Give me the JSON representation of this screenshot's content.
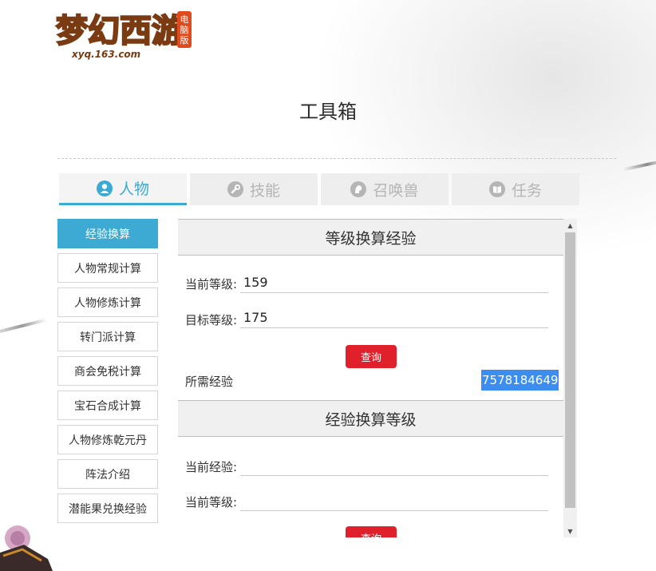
{
  "header": {
    "logo_text": "梦幻西游",
    "logo_badge": "电脑版",
    "logo_url_text": "xyq.163.com"
  },
  "page": {
    "title": "工具箱"
  },
  "tabs": [
    {
      "label": "人物",
      "icon": "person-icon",
      "active": true
    },
    {
      "label": "技能",
      "icon": "wrench-icon",
      "active": false
    },
    {
      "label": "召唤兽",
      "icon": "pet-icon",
      "active": false
    },
    {
      "label": "任务",
      "icon": "book-icon",
      "active": false
    }
  ],
  "submenu": [
    {
      "label": "经验换算",
      "active": true
    },
    {
      "label": "人物常规计算"
    },
    {
      "label": "人物修炼计算"
    },
    {
      "label": "转门派计算"
    },
    {
      "label": "商会免税计算"
    },
    {
      "label": "宝石合成计算"
    },
    {
      "label": "人物修炼乾元丹"
    },
    {
      "label": "阵法介绍"
    },
    {
      "label": "潜能果兑换经验"
    }
  ],
  "level_to_exp": {
    "title": "等级换算经验",
    "current_level_label": "当前等级:",
    "current_level_value": "159",
    "target_level_label": "目标等级:",
    "target_level_value": "175",
    "query_label": "查询",
    "result_label": "所需经验",
    "result_value": "7578184649"
  },
  "exp_to_level": {
    "title": "经验换算等级",
    "current_exp_label": "当前经验:",
    "current_exp_value": "",
    "current_level_label": "当前等级:",
    "current_level_value": "",
    "query_label": "查询"
  },
  "colors": {
    "accent": "#3caad2",
    "query_button": "#e0202a",
    "selection": "#3b8ef0"
  }
}
